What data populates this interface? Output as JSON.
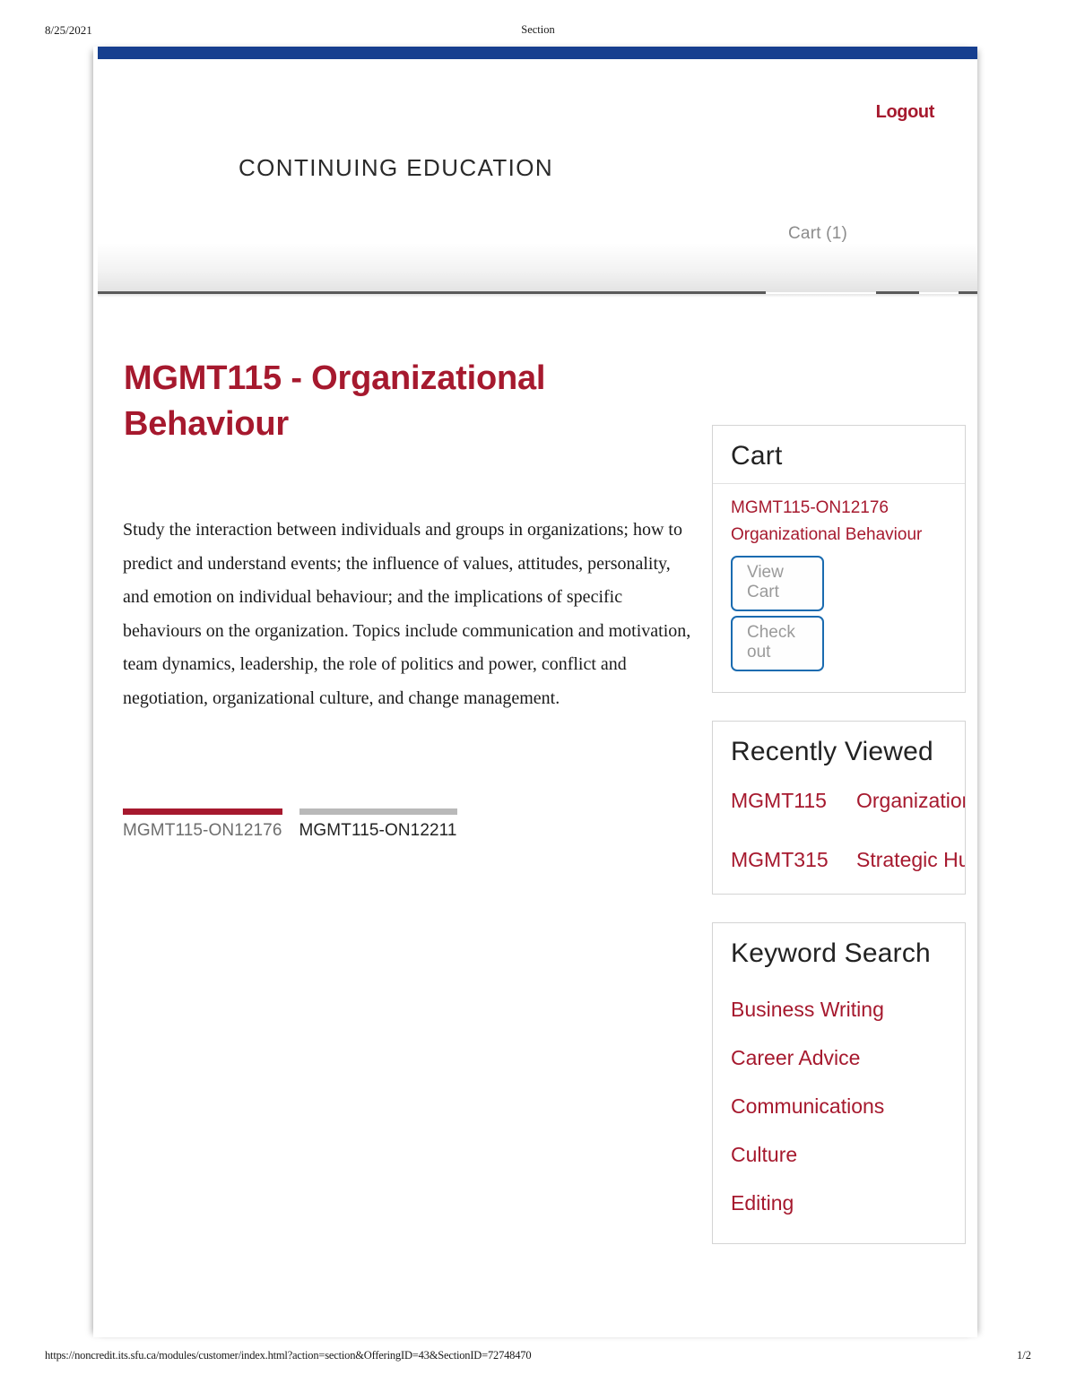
{
  "print": {
    "date": "8/25/2021",
    "doc_title": "Section",
    "url": "https://noncredit.its.sfu.ca/modules/customer/index.html?action=section&OfferingID=43&SectionID=72748470",
    "page_number": "1/2"
  },
  "colors": {
    "accent_red": "#a6192e",
    "top_bar_blue": "#173f8f",
    "button_border_blue": "#1a6bb0",
    "muted_gray": "#8c8c8c"
  },
  "header": {
    "logout_label": "Logout",
    "brand": "CONTINUING EDUCATION",
    "cart_indicator": "Cart (1)"
  },
  "main": {
    "course_title": "MGMT115 - Organizational Behaviour",
    "course_description": "Study the interaction between individuals and groups in organizations; how to predict and understand events; the influence of values, attitudes, personality, and emotion on individual behaviour; and the implications of specific behaviours on the organization. Topics include communication and motivation, team dynamics, leadership, the role of politics and power, conflict and negotiation, organizational culture, and change management.",
    "tabs": [
      {
        "label": "MGMT115-ON12176",
        "active": true
      },
      {
        "label": "MGMT115-ON12211",
        "active": false
      }
    ]
  },
  "cart_panel": {
    "title": "Cart",
    "item_code": "MGMT115-ON12176",
    "item_name": "Organizational Behaviour",
    "view_cart_label": "View Cart",
    "checkout_label": "Check out"
  },
  "recently_viewed_panel": {
    "title": "Recently Viewed",
    "items": [
      {
        "code": "MGMT115",
        "name": "Organizational Behaviour"
      },
      {
        "code": "MGMT315",
        "name": "Strategic Human Resources Planning"
      }
    ]
  },
  "keyword_search_panel": {
    "title": "Keyword Search",
    "keywords": [
      "Business Writing",
      "Career Advice",
      "Communications",
      "Culture",
      "Editing"
    ]
  }
}
